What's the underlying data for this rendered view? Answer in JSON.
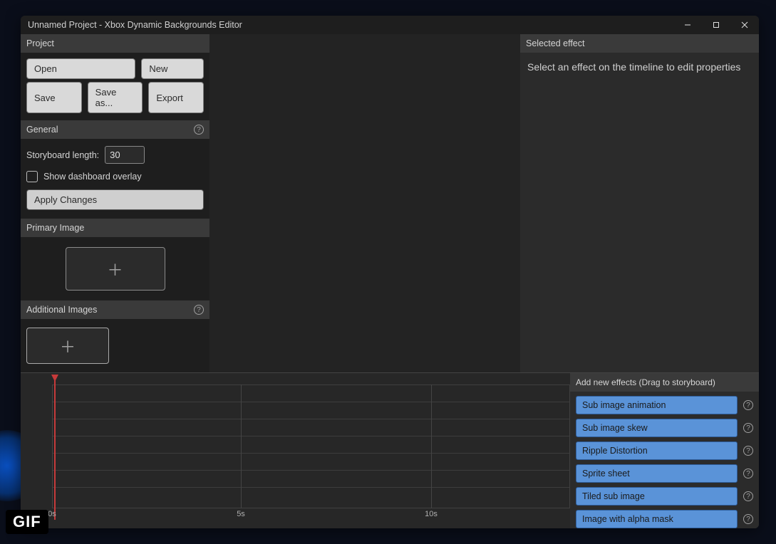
{
  "titlebar": {
    "title": "Unnamed Project - Xbox Dynamic Backgrounds Editor"
  },
  "sidebar": {
    "project": {
      "header": "Project",
      "open": "Open",
      "new": "New",
      "save": "Save",
      "save_as": "Save as...",
      "export": "Export"
    },
    "general": {
      "header": "General",
      "storyboard_length_label": "Storyboard length:",
      "storyboard_length_value": "30",
      "show_overlay_label": "Show dashboard overlay",
      "apply": "Apply Changes"
    },
    "primary_image": {
      "header": "Primary Image"
    },
    "additional_images": {
      "header": "Additional Images"
    }
  },
  "right": {
    "header": "Selected effect",
    "placeholder": "Select an effect on the timeline to edit properties"
  },
  "timeline": {
    "ticks": [
      "0s",
      "5s",
      "10s"
    ]
  },
  "effects": {
    "header": "Add new effects (Drag to storyboard)",
    "items": [
      "Sub image animation",
      "Sub image skew",
      "Ripple Distortion",
      "Sprite sheet",
      "Tiled sub image",
      "Image with alpha mask"
    ]
  },
  "badge": "GIF"
}
